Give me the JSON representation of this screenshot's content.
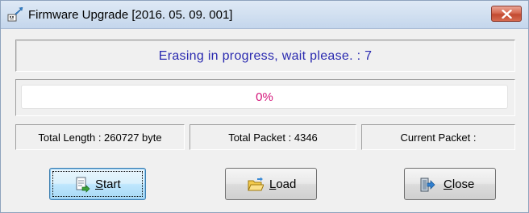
{
  "window": {
    "title": "Firmware Upgrade [2016. 05. 09. 001]"
  },
  "status": {
    "message": "Erasing in progress, wait please.  : 7"
  },
  "progress": {
    "text": "0%",
    "value": 0
  },
  "info": {
    "total_length": "Total Length : 260727 byte",
    "total_packet": "Total Packet : 4346",
    "current_packet": "Current Packet :"
  },
  "buttons": {
    "start": {
      "mnemonic": "S",
      "rest": "tart"
    },
    "load": {
      "mnemonic": "L",
      "rest": "oad"
    },
    "close": {
      "mnemonic": "C",
      "rest": "lose"
    }
  },
  "icons": {
    "app": "firmware-upgrade-icon",
    "close": "close-x-icon",
    "start": "document-arrow-icon",
    "load": "open-folder-icon",
    "close_button": "exit-door-icon"
  },
  "colors": {
    "status_text": "#2a2ab0",
    "progress_text": "#d4157a",
    "close_button": "#c24a31"
  }
}
